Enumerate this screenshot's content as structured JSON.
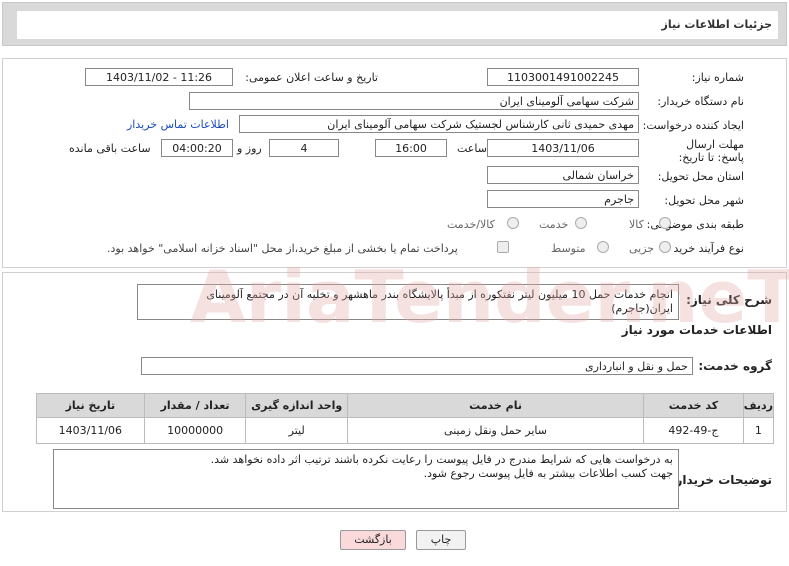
{
  "header": {
    "title": "جزئیات اطلاعات نیاز"
  },
  "fields": {
    "need_number_label": "شماره نیاز:",
    "need_number": "1103001491002245",
    "announce_label": "تاریخ و ساعت اعلان عمومی:",
    "announce_value": "1403/11/02 - 11:26",
    "buyer_org_label": "نام دستگاه خریدار:",
    "buyer_org": "شرکت سهامی آلومینای ایران",
    "creator_label": "ایجاد کننده درخواست:",
    "creator": "مهدی حمیدی ثانی کارشناس لجستیک شرکت سهامی آلومینای ایران",
    "contact_link": "اطلاعات تماس خریدار",
    "deadline_label": "مهلت ارسال پاسخ: تا تاریخ:",
    "deadline_date": "1403/11/06",
    "time_label": "ساعت",
    "deadline_time": "16:00",
    "days_value": "4",
    "days_label": "روز و",
    "remaining_time": "04:00:20",
    "remaining_label": "ساعت باقی مانده",
    "province_label": "استان محل تحویل:",
    "province": "خراسان شمالی",
    "city_label": "شهر محل تحویل:",
    "city": "جاجرم",
    "category_label": "طبقه بندی موضوعی:",
    "category_options": [
      "کالا",
      "خدمت",
      "کالا/خدمت"
    ],
    "process_label": "نوع فرآیند خرید :",
    "process_options": [
      "جزیی",
      "متوسط"
    ],
    "payment_note": "پرداخت تمام یا بخشی از مبلغ خرید،از محل \"اسناد خزانه اسلامی\" خواهد بود."
  },
  "summary": {
    "label": "شرح کلی نیاز:",
    "text_line1": "انجام خدمات حمل 10 میلیون لیتر نفتکوره از مبدأ پالایشگاه بندر ماهشهر و تخلیه آن در مجتمع آلومینای",
    "text_line2": "ایران(جاجرم)"
  },
  "services": {
    "section_title": "اطلاعات خدمات مورد نیاز",
    "group_label": "گروه خدمت:",
    "group_value": "حمل و نقل و انبارداری",
    "columns": [
      "ردیف",
      "کد خدمت",
      "نام خدمت",
      "واحد اندازه گیری",
      "تعداد / مقدار",
      "تاریخ نیاز"
    ],
    "rows": [
      {
        "index": "1",
        "code": "ج-49-492",
        "name": "سایر حمل ونقل زمینی",
        "unit": "لیتر",
        "qty": "10000000",
        "date": "1403/11/06"
      }
    ]
  },
  "buyer_notes": {
    "label": "توضیحات خریدار:",
    "line1": "به درخواست هایی که شرایط مندرج در فایل پیوست را رعایت نکرده باشند ترتیب اثر داده نخواهد شد.",
    "line2": "جهت کسب اطلاعات بیشتر به فایل پیوست رجوع شود."
  },
  "buttons": {
    "print": "چاپ",
    "back": "بازگشت"
  },
  "watermark": "AriaTender.neT",
  "colors": {
    "header_bg": "#d9d9d9",
    "link": "#1a4bbd",
    "back_btn": "#f9d9d9"
  }
}
